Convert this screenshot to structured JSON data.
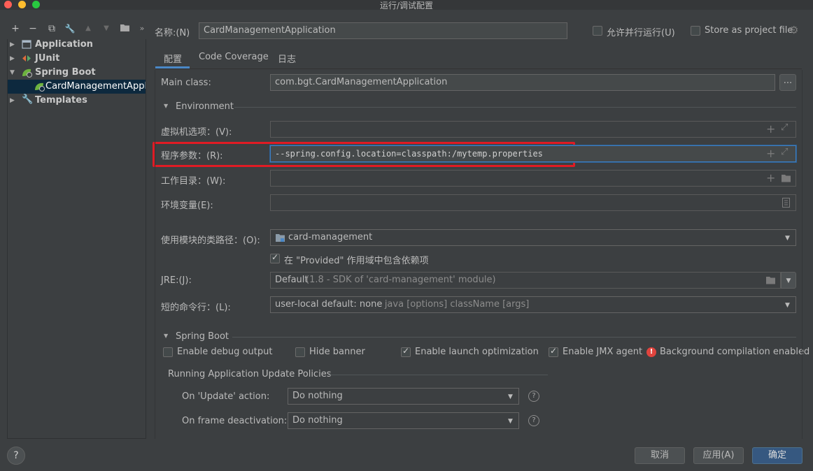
{
  "window": {
    "title": "运行/调试配置"
  },
  "toolbar": {
    "add": "+",
    "remove": "−",
    "copy": "⧉",
    "edit": "🔧",
    "up": "▲",
    "down": "▼",
    "folder": "▶",
    "more": "»"
  },
  "tree": {
    "items": [
      {
        "label": "Application"
      },
      {
        "label": "JUnit"
      },
      {
        "label": "Spring Boot"
      },
      {
        "label": "CardManagementApplic"
      },
      {
        "label": "Templates"
      }
    ]
  },
  "header": {
    "name_label": "名称:(N)",
    "name_value": "CardManagementApplication",
    "allow_parallel": "允许并行运行(U)",
    "store_project": "Store as project file"
  },
  "tabs": [
    {
      "label": "配置"
    },
    {
      "label": "Code Coverage"
    },
    {
      "label": "日志"
    }
  ],
  "config": {
    "main_class_label": "Main class:",
    "main_class_value": "com.bgt.CardManagementApplication",
    "browse": "...",
    "environment": "Environment",
    "vm_label": "虚拟机选项：(V):",
    "vm_value": "",
    "args_label": "程序参数：(R):",
    "args_value": "--spring.config.location=classpath:/mytemp.properties",
    "workdir_label": "工作目录：(W):",
    "workdir_value": "",
    "env_label": "环境变量(E):",
    "env_value": "",
    "module_label": "使用模块的类路径：(O):",
    "module_value": "card-management",
    "provided_label": "在 \"Provided\" 作用域中包含依赖项",
    "jre_label": "JRE:(J):",
    "jre_value": "Default",
    "jre_hint": "(1.8 - SDK of 'card-management' module)",
    "shortcmd_label": "短的命令行：(L):",
    "shortcmd_value": "user-local default: none",
    "shortcmd_hint": "- java [options] className [args]"
  },
  "springboot": {
    "title": "Spring Boot",
    "debug_output": "Enable debug output",
    "hide_banner": "Hide banner",
    "launch_opt": "Enable launch optimization",
    "jmx_agent": "Enable JMX agent",
    "bg_compile": "Background compilation enabled",
    "policies_title": "Running Application Update Policies",
    "update_label": "On 'Update' action:",
    "update_value": "Do nothing",
    "frame_label": "On frame deactivation:",
    "frame_value": "Do nothing"
  },
  "footer": {
    "cancel": "取消",
    "apply": "应用(A)",
    "ok": "确定",
    "help": "?"
  }
}
